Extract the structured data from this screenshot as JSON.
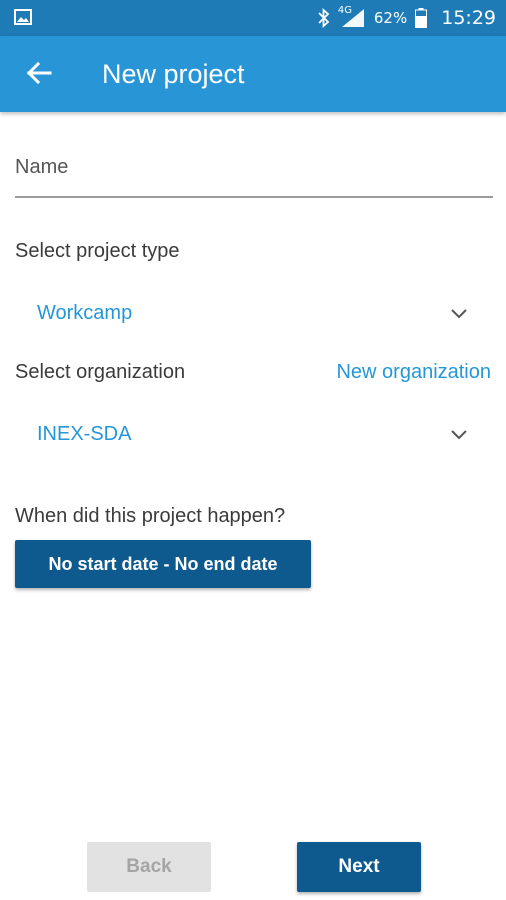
{
  "status_bar": {
    "network": "4G",
    "battery_percent": "62%",
    "time": "15:29",
    "icons": [
      "gallery-icon",
      "bluetooth-icon",
      "signal-icon",
      "battery-icon"
    ]
  },
  "app_bar": {
    "title": "New project",
    "back_icon": "arrow-left-icon",
    "color": "#2896d6"
  },
  "form": {
    "name": {
      "placeholder": "Name",
      "value": ""
    },
    "project_type": {
      "label": "Select project type",
      "selected": "Workcamp"
    },
    "organization": {
      "label": "Select organization",
      "selected": "INEX-SDA",
      "new_link": "New organization"
    },
    "dates": {
      "question": "When did this project happen?",
      "button": "No start date - No end date"
    }
  },
  "footer": {
    "back_label": "Back",
    "back_enabled": false,
    "next_label": "Next"
  },
  "colors": {
    "primary": "#2896d6",
    "primary_dark": "#0e5a8e",
    "accent_text": "#2596d8"
  }
}
